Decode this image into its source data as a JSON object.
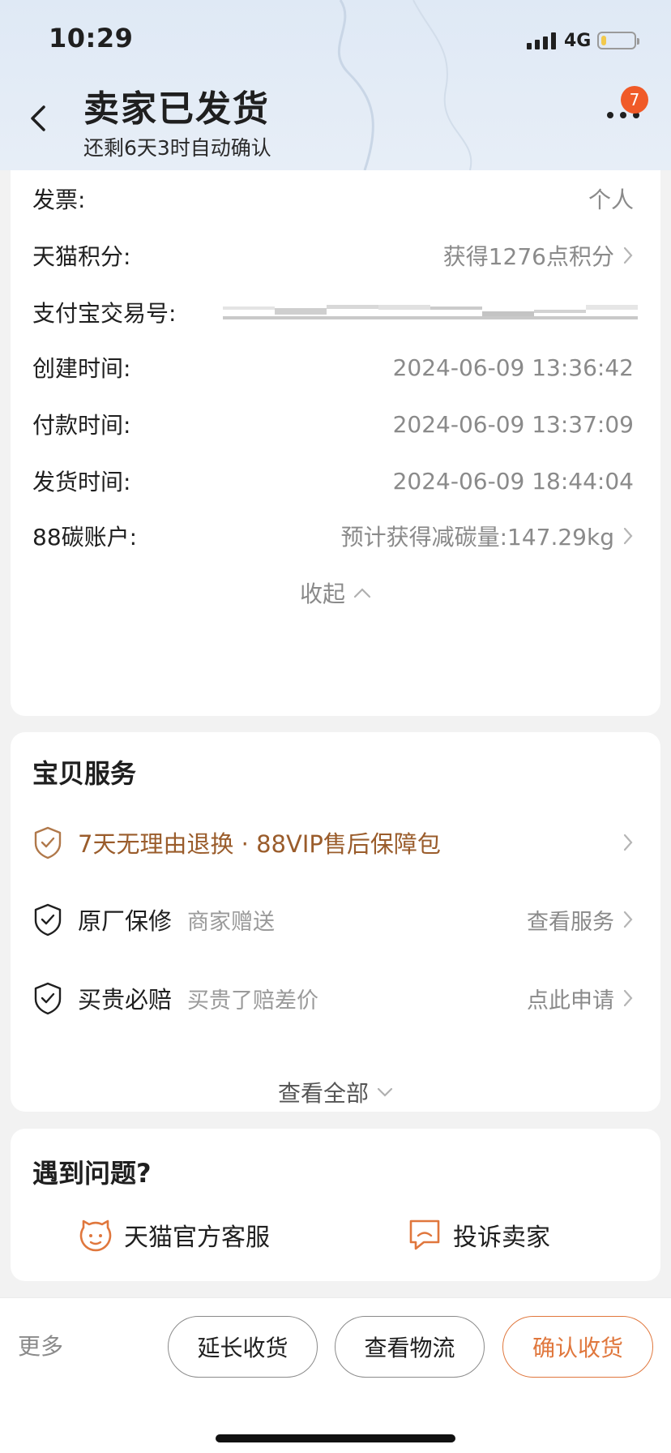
{
  "status_bar": {
    "time": "10:29",
    "network": "4G",
    "battery_level": 0.15,
    "battery_color": "#f2c94c"
  },
  "header": {
    "title": "卖家已发货",
    "subtitle": "还剩6天3时自动确认",
    "notification_count": "7",
    "back_icon": "chevron-left-icon",
    "more_icon": "more-dots-icon",
    "background_color": "#e2ebf6"
  },
  "order_details": {
    "rows": [
      {
        "label": "发票:",
        "value": "个人",
        "has_chevron": false
      },
      {
        "label": "天猫积分:",
        "value": "获得1276点积分",
        "has_chevron": true
      },
      {
        "label": "支付宝交易号:",
        "value": "",
        "masked": true
      },
      {
        "label": "创建时间:",
        "value": "2024-06-09 13:36:42",
        "has_chevron": false
      },
      {
        "label": "付款时间:",
        "value": "2024-06-09 13:37:09",
        "has_chevron": false
      },
      {
        "label": "发货时间:",
        "value": "2024-06-09 18:44:04",
        "has_chevron": false
      },
      {
        "label": "88碳账户:",
        "value": "预计获得减碳量:147.29kg",
        "has_chevron": true
      }
    ],
    "collapse_label": "收起"
  },
  "services": {
    "title": "宝贝服务",
    "items": [
      {
        "name": "7天无理由退换 · 88VIP售后保障包",
        "desc": "",
        "action": "",
        "icon": "shield-check-icon",
        "accent": "#9a5c2b"
      },
      {
        "name": "原厂保修",
        "desc": "商家赠送",
        "action": "查看服务",
        "icon": "shield-check-icon"
      },
      {
        "name": "买贵必赔",
        "desc": "买贵了赔差价",
        "action": "点此申请",
        "icon": "shield-check-icon"
      }
    ],
    "view_all_label": "查看全部"
  },
  "help": {
    "title": "遇到问题?",
    "items": [
      {
        "label": "天猫官方客服",
        "icon": "tmall-cat-icon"
      },
      {
        "label": "投诉卖家",
        "icon": "complaint-chat-icon"
      }
    ],
    "accent_color": "#e0773d"
  },
  "bottom_bar": {
    "more_label": "更多",
    "buttons": [
      {
        "label": "延长收货",
        "primary": false
      },
      {
        "label": "查看物流",
        "primary": false
      },
      {
        "label": "确认收货",
        "primary": true
      }
    ],
    "primary_color": "#e0773d"
  }
}
